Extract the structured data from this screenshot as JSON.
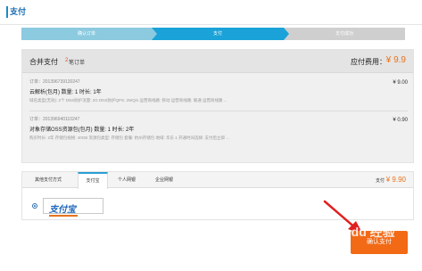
{
  "header": {
    "title": "支付"
  },
  "steps": [
    {
      "label": "确认订单"
    },
    {
      "label": "支付"
    },
    {
      "label": "支付成功"
    }
  ],
  "order_summary": {
    "label": "合并支付",
    "count": "2",
    "count_suffix": "笔订单",
    "due_label": "应付费用：",
    "due_value": "¥ 9.9"
  },
  "orders": [
    {
      "id": "订单：2013967391302​47",
      "name": "云解析(包月) 数量: 1 时长: 1年",
      "desc": "域名类型(无效): 2个 DNS防护流量: 2G DNS防护QPS: 2WQ/s 运营商线路: 移动 运营商线路: 联通 运营商线路 ...",
      "price": "¥ 9.00"
    },
    {
      "id": "订单：2013969401102​47",
      "name": "对象存储OSS资源包(包月) 数量: 1 时长: 2年",
      "desc": "购买时长: 2年 存储包规格: 40GB 资源包类型: 存储包 套餐: 杭州存储包 地域: 华东 1 开通时间选择: 支付后立即 ...",
      "price": "¥ 0.90"
    }
  ],
  "payment": {
    "tabs": [
      {
        "label": "其他支付方式"
      },
      {
        "label": "支付宝"
      },
      {
        "label": "个人网银"
      },
      {
        "label": "企业网银"
      }
    ],
    "pay_label": "支付",
    "pay_value": "¥ 9.90",
    "alipay_logo": "支付宝",
    "confirm_button": "确认支付"
  },
  "watermark": {
    "line1": "Bai du 经验",
    "line2": "jingyan.baidu.com"
  },
  "colors": {
    "accent": "#1ba2d8",
    "price": "#e8721c",
    "button": "#f26a16",
    "arrow": "#e02020"
  }
}
